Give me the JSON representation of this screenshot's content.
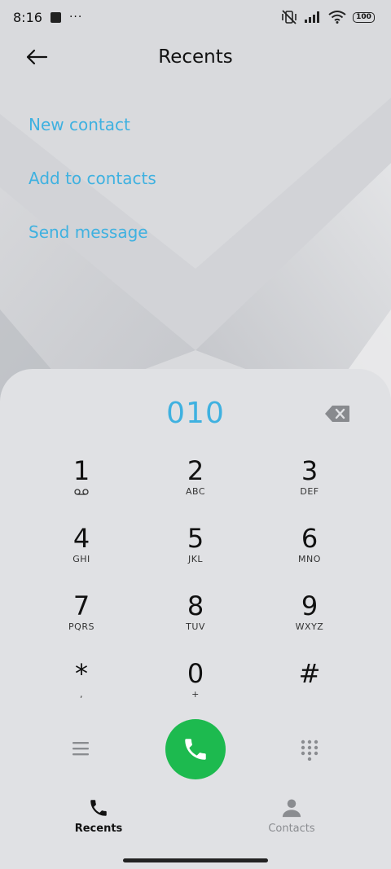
{
  "status_bar": {
    "time": "8:16",
    "dots": "···",
    "battery": "100"
  },
  "header": {
    "title": "Recents"
  },
  "actions": [
    {
      "label": "New contact"
    },
    {
      "label": "Add to contacts"
    },
    {
      "label": "Send message"
    }
  ],
  "dialer": {
    "number": "010",
    "keys": [
      [
        {
          "digit": "1",
          "letters": ""
        },
        {
          "digit": "2",
          "letters": "ABC"
        },
        {
          "digit": "3",
          "letters": "DEF"
        }
      ],
      [
        {
          "digit": "4",
          "letters": "GHI"
        },
        {
          "digit": "5",
          "letters": "JKL"
        },
        {
          "digit": "6",
          "letters": "MNO"
        }
      ],
      [
        {
          "digit": "7",
          "letters": "PQRS"
        },
        {
          "digit": "8",
          "letters": "TUV"
        },
        {
          "digit": "9",
          "letters": "WXYZ"
        }
      ],
      [
        {
          "digit": "*",
          "letters": ","
        },
        {
          "digit": "0",
          "letters": "+"
        },
        {
          "digit": "#",
          "letters": ""
        }
      ]
    ]
  },
  "bottom_nav": {
    "recents": "Recents",
    "contacts": "Contacts"
  },
  "colors": {
    "accent": "#3fb1e0",
    "call_green": "#1dba4f",
    "background": "#d9dadd"
  }
}
